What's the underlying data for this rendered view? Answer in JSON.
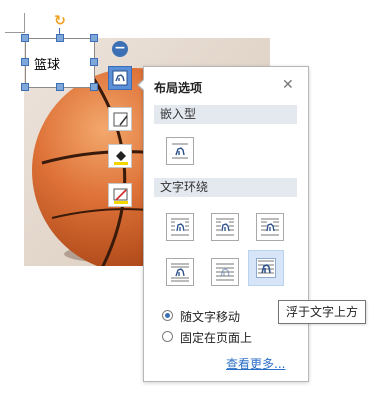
{
  "textbox": {
    "text": "篮球"
  },
  "layout_panel": {
    "title": "布局选项",
    "close_glyph": "✕",
    "inline_section": "嵌入型",
    "wrap_section": "文字环绕",
    "inline_options": [
      {
        "name": "嵌入型",
        "icon": "inline-layout-icon"
      }
    ],
    "wrap_options": [
      {
        "icon": "square-wrap-icon"
      },
      {
        "icon": "tight-wrap-icon"
      },
      {
        "icon": "through-wrap-icon"
      },
      {
        "icon": "top-bottom-wrap-icon"
      },
      {
        "icon": "behind-text-icon"
      },
      {
        "icon": "in-front-of-text-icon"
      }
    ],
    "position_options": [
      {
        "label": "随文字移动",
        "selected": true
      },
      {
        "label": "固定在页面上",
        "selected": false
      }
    ],
    "see_more": "查看更多..."
  },
  "tooltip": "浮于文字上方",
  "side_buttons": [
    "layout-options-icon",
    "shape-outline-icon",
    "fill-icon",
    "line-color-icon"
  ],
  "colors": {
    "accent": "#3d6fb5",
    "hover_bg": "#d6e6f8",
    "section_bg": "#e4e8ef",
    "link": "#2c6fc7",
    "fill_yellow": "#f2d600",
    "ball_orange": "#de7238"
  }
}
